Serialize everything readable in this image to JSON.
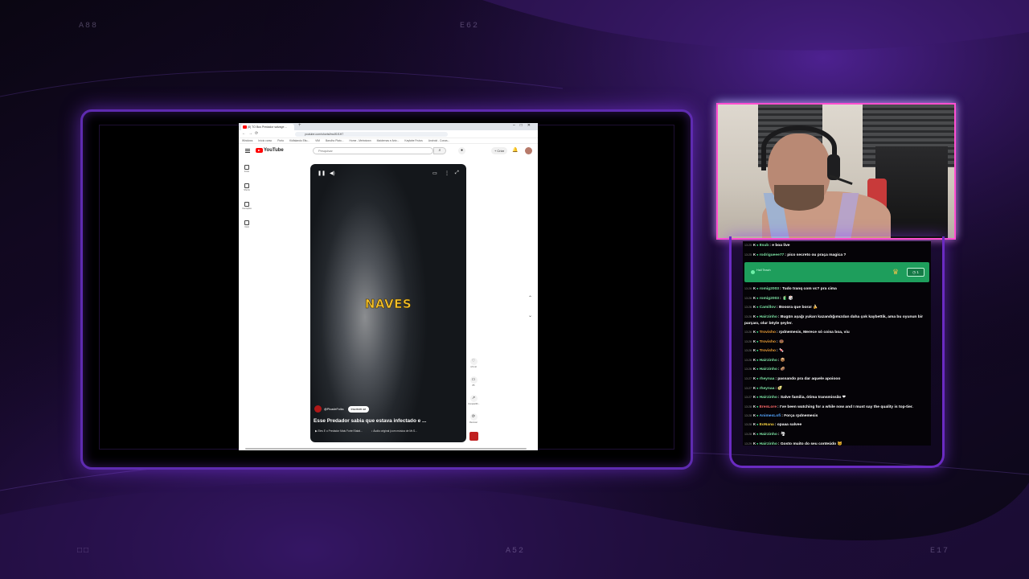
{
  "corners": {
    "top_left": "A88",
    "top_center": "E62",
    "bottom_left": "□□",
    "bottom_center": "A52",
    "bottom_right": "E17"
  },
  "colors": {
    "frame_purple": "#5e2bb0",
    "webcam_border": "#ff4fd0",
    "notice_green": "#1e9e5c",
    "naves_text": "#f6c12a"
  },
  "browser": {
    "tab_title": "(8) TO Bus Predador salvage ...",
    "url": "youtube.com/shorts/bw4f1f1H7",
    "bookmarks": [
      "Windows",
      "Início curso",
      "Porto",
      "Kidfalando Eitu...",
      "VIM",
      "Barulho Plato...",
      "Home - Metrotown",
      "Maidernas e Aniv...",
      "Kayfahe Frutos",
      "Android - Conas..."
    ],
    "search_placeholder": "Pesquisar",
    "create_label": "+ Criar",
    "logo_text": "YouTube",
    "sidebar": [
      {
        "label": "Início",
        "icon": "home-icon"
      },
      {
        "label": "Shorts",
        "icon": "shorts-icon"
      },
      {
        "label": "Inscrições",
        "icon": "subscriptions-icon"
      },
      {
        "label": "Você",
        "icon": "you-icon"
      }
    ]
  },
  "short": {
    "overlay_text": "NAVES",
    "channel": "@PicadeFolks",
    "subscribe_label": "Inscrever-se",
    "title": "Esse Predador sabia que estava infectado e ...",
    "meta1": "▶ Eles E o Predador Mais Forte! Batal...",
    "meta2": "♪ Áudio original (com música de Mr.S...",
    "actions": [
      {
        "label": "4,5 mil",
        "icon": "like-icon",
        "glyph": "♡"
      },
      {
        "label": "85",
        "icon": "comment-icon",
        "glyph": "▭"
      },
      {
        "label": "Compartilh...",
        "icon": "share-icon",
        "glyph": "↗"
      },
      {
        "label": "Remixar",
        "icon": "remix-icon",
        "glyph": "⟳"
      }
    ]
  },
  "chat": {
    "messages": [
      {
        "ts": "13:25",
        "user": "Itsub",
        "color": "#7ee3a4",
        "text": ": e boa live"
      },
      {
        "ts": "13:25",
        "user": "rodrigueee77",
        "color": "#7ee3a4",
        "text": ": pico secreto ou praça magica ?"
      },
      {
        "ts": "13:26",
        "user": "romig2003",
        "color": "#7ee3a4",
        "text": ": Tudo tranq com vc? pra cima"
      },
      {
        "ts": "13:26",
        "user": "romig2003",
        "color": "#7ee3a4",
        "text": ": 🧃 🎲"
      },
      {
        "ts": "13:26",
        "user": "Camillov",
        "color": "#7ee3a4",
        "text": ": Booora que bora! 🍌"
      },
      {
        "ts": "13:26",
        "user": "Hairzinho",
        "color": "#7ee3a4",
        "text": ": Bugün aşağı yukarı kazandığımızdan daha çok kaybettik, ama bu oyunun bir parçası, olur böyle şeyler.",
        "wrap": true
      },
      {
        "ts": "13:26",
        "user": "Trovisho",
        "color": "#f0a238",
        "text": ": rpdnemesis, Merece só coisa boa, viu"
      },
      {
        "ts": "13:26",
        "user": "Trovisho",
        "color": "#f0a238",
        "text": ": 🍩"
      },
      {
        "ts": "13:26",
        "user": "Trovisho",
        "color": "#f0a238",
        "text": ": 🍬"
      },
      {
        "ts": "13:26",
        "user": "Hairzinho",
        "color": "#7ee3a4",
        "text": ": 📦"
      },
      {
        "ts": "13:26",
        "user": "Hairzinho",
        "color": "#7ee3a4",
        "text": ": 🥔"
      },
      {
        "ts": "13:27",
        "user": "rheynaa",
        "color": "#7ee3a4",
        "text": ": passando pra dar aquele apoiooo"
      },
      {
        "ts": "13:27",
        "user": "rheynaa",
        "color": "#7ee3a4",
        "text": ": 🥑"
      },
      {
        "ts": "13:27",
        "user": "Hairzinho",
        "color": "#7ee3a4",
        "text": ": Salve familia, ótima transmissão ❤"
      },
      {
        "ts": "13:28",
        "user": "ErenLore",
        "color": "#ff6b6b",
        "text": ": I've been watching for a while now and I must say the quality is top-tier.",
        "wrap": true
      },
      {
        "ts": "13:28",
        "user": "AnimesLofi",
        "color": "#55a6ff",
        "text": ": Força rpdnemesis"
      },
      {
        "ts": "13:28",
        "user": "EoNana",
        "color": "#f4d03f",
        "text": ": opaaa salvee"
      },
      {
        "ts": "13:28",
        "user": "Hairzinho",
        "color": "#7ee3a4",
        "text": ": 🌪"
      },
      {
        "ts": "13:29",
        "user": "Hairzinho",
        "color": "#7ee3a4",
        "text": ": Gosto muito do seu conteúdo 🐱"
      }
    ],
    "notice": {
      "text": "Hall Teach",
      "counter": "1"
    }
  }
}
